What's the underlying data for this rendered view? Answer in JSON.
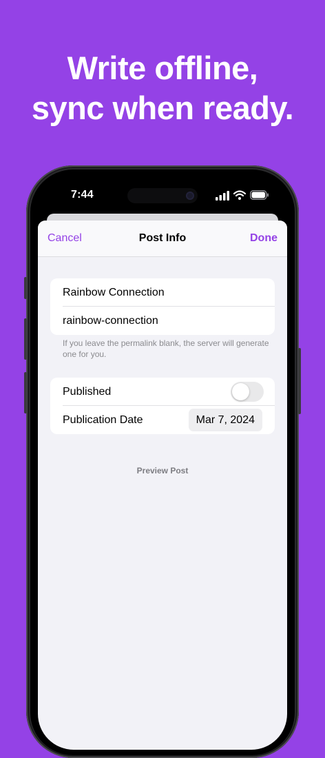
{
  "headline": {
    "line1": "Write offline,",
    "line2": "sync when ready."
  },
  "status_bar": {
    "time": "7:44"
  },
  "nav": {
    "cancel_label": "Cancel",
    "title": "Post Info",
    "done_label": "Done"
  },
  "post": {
    "title": "Rainbow Connection",
    "permalink": "rainbow-connection",
    "permalink_hint": "If you leave the permalink blank, the server will generate one for you."
  },
  "publishing": {
    "published_label": "Published",
    "published": false,
    "date_label": "Publication Date",
    "date_value": "Mar 7, 2024"
  },
  "actions": {
    "preview_label": "Preview Post"
  },
  "colors": {
    "brand_purple": "#9442E6",
    "sheet_background": "#F2F2F7"
  }
}
